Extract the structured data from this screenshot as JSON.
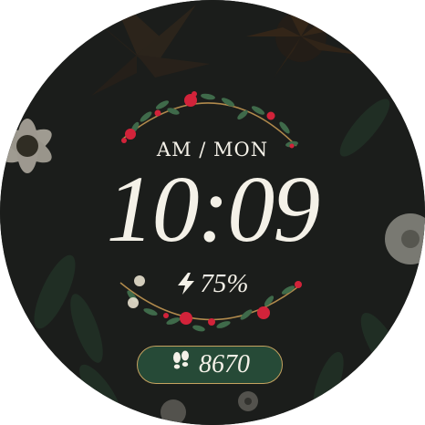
{
  "watch_face": {
    "period_day": "AM / MON",
    "time": "10:09",
    "battery": "75%",
    "steps": "8670"
  },
  "icons": {
    "battery": "lightning-bolt-icon",
    "steps": "footprints-icon"
  },
  "colors": {
    "background": "#1b1d1b",
    "text": "#f4f1e8",
    "steps_pill": "#264a37",
    "steps_border": "#c5a25f",
    "berry": "#d2233a",
    "leaf": "#3f6a4a"
  }
}
